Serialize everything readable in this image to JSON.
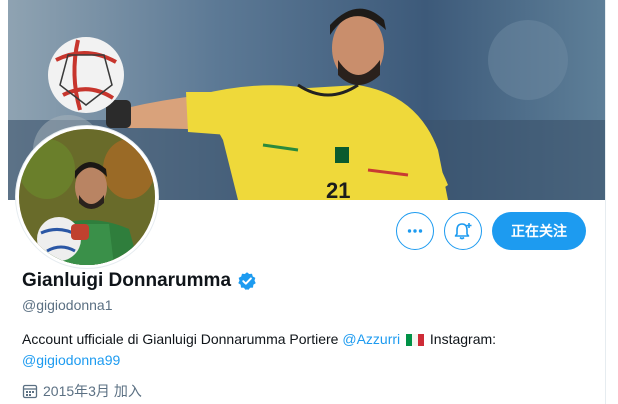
{
  "profile": {
    "display_name": "Gianluigi Donnarumma",
    "handle": "@gigiodonna1",
    "bio_prefix": "Account ufficiale di Gianluigi Donnarumma Portiere ",
    "bio_link_club": "@Azzurri",
    "bio_instagram_label": " Instagram:",
    "bio_link_instagram": "@gigiodonna99",
    "joined": "2015年3月 加入"
  },
  "actions": {
    "more_icon": "more-horizontal-icon",
    "notify_icon": "bell-plus-icon",
    "follow_label": "正在关注"
  },
  "colors": {
    "accent": "#1d9bf0",
    "secondary_text": "#5b7083",
    "jersey_yellow": "#f1df3e"
  }
}
